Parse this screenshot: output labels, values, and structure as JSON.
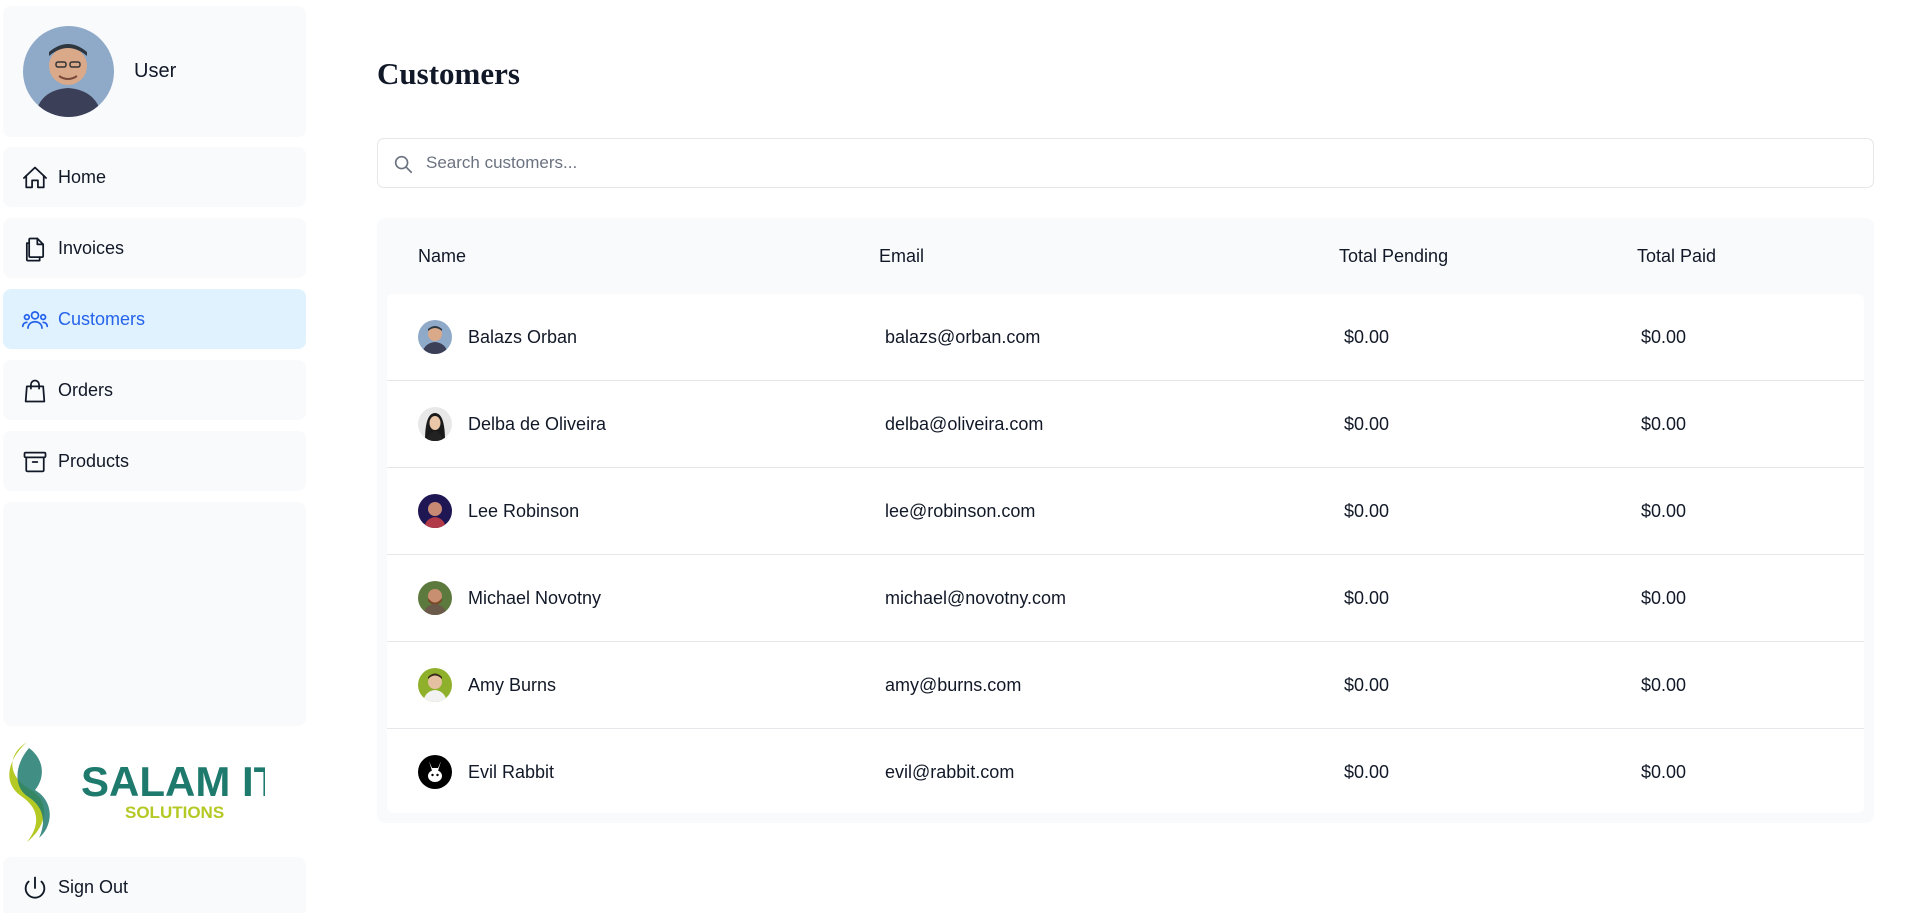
{
  "user": {
    "name": "User"
  },
  "nav": {
    "items": [
      {
        "label": "Home",
        "icon": "home-icon",
        "active": false
      },
      {
        "label": "Invoices",
        "icon": "documents-icon",
        "active": false
      },
      {
        "label": "Customers",
        "icon": "users-icon",
        "active": true
      },
      {
        "label": "Orders",
        "icon": "shopping-bag-icon",
        "active": false
      },
      {
        "label": "Products",
        "icon": "archive-box-icon",
        "active": false
      }
    ],
    "signout_label": "Sign Out"
  },
  "logo": {
    "line1": "SALAM IT",
    "line2": "SOLUTIONS"
  },
  "page": {
    "title": "Customers"
  },
  "search": {
    "placeholder": "Search customers..."
  },
  "table": {
    "columns": [
      "Name",
      "Email",
      "Total Pending",
      "Total Paid"
    ],
    "rows": [
      {
        "name": "Balazs Orban",
        "email": "balazs@orban.com",
        "total_pending": "$0.00",
        "total_paid": "$0.00"
      },
      {
        "name": "Delba de Oliveira",
        "email": "delba@oliveira.com",
        "total_pending": "$0.00",
        "total_paid": "$0.00"
      },
      {
        "name": "Lee Robinson",
        "email": "lee@robinson.com",
        "total_pending": "$0.00",
        "total_paid": "$0.00"
      },
      {
        "name": "Michael Novotny",
        "email": "michael@novotny.com",
        "total_pending": "$0.00",
        "total_paid": "$0.00"
      },
      {
        "name": "Amy Burns",
        "email": "amy@burns.com",
        "total_pending": "$0.00",
        "total_paid": "$0.00"
      },
      {
        "name": "Evil Rabbit",
        "email": "evil@rabbit.com",
        "total_pending": "$0.00",
        "total_paid": "$0.00"
      }
    ]
  },
  "colors": {
    "accent": "#2563eb",
    "active_bg": "#e0f2fe",
    "panel_bg": "#f9fafb",
    "logo_teal": "#1f7a6e",
    "logo_lime": "#b5c924"
  }
}
